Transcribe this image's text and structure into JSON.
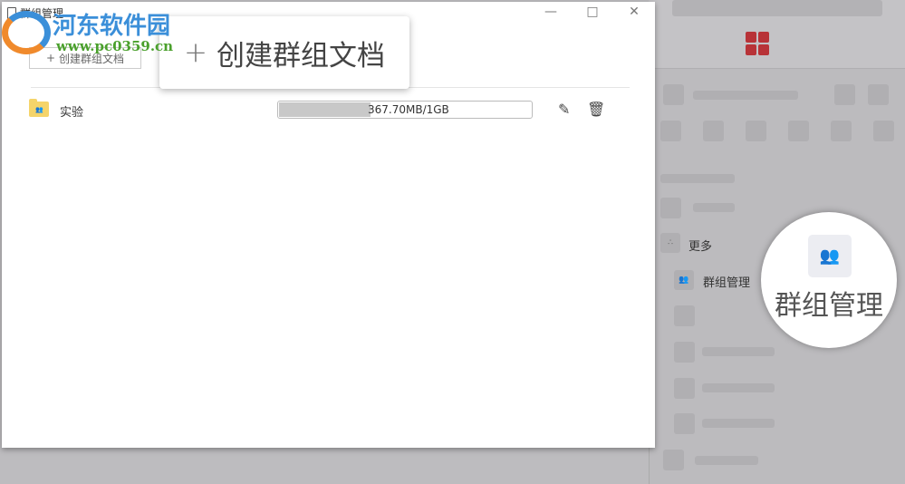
{
  "window": {
    "title": "群组管理",
    "minimize": "—",
    "maximize": "□",
    "close": "✕"
  },
  "toolbar": {
    "create_plus": "+",
    "create_label": "创建群组文档"
  },
  "rows": [
    {
      "name": "实验",
      "usage_text": "367.70MB/1GB",
      "usage_fraction": 0.359,
      "folder_icon": "group-folder-icon",
      "edit_icon": "edit-icon",
      "delete_icon": "trash-icon"
    }
  ],
  "callout": {
    "plus": "+",
    "label": "创建群组文档"
  },
  "sidebar": {
    "more_label": "更多",
    "group_manage_label": "群组管理"
  },
  "magnifier": {
    "label": "群组管理"
  },
  "watermark": {
    "name": "河东软件园",
    "url": "www.pc0359.cn"
  },
  "colors": {
    "accent": "#b83338"
  }
}
